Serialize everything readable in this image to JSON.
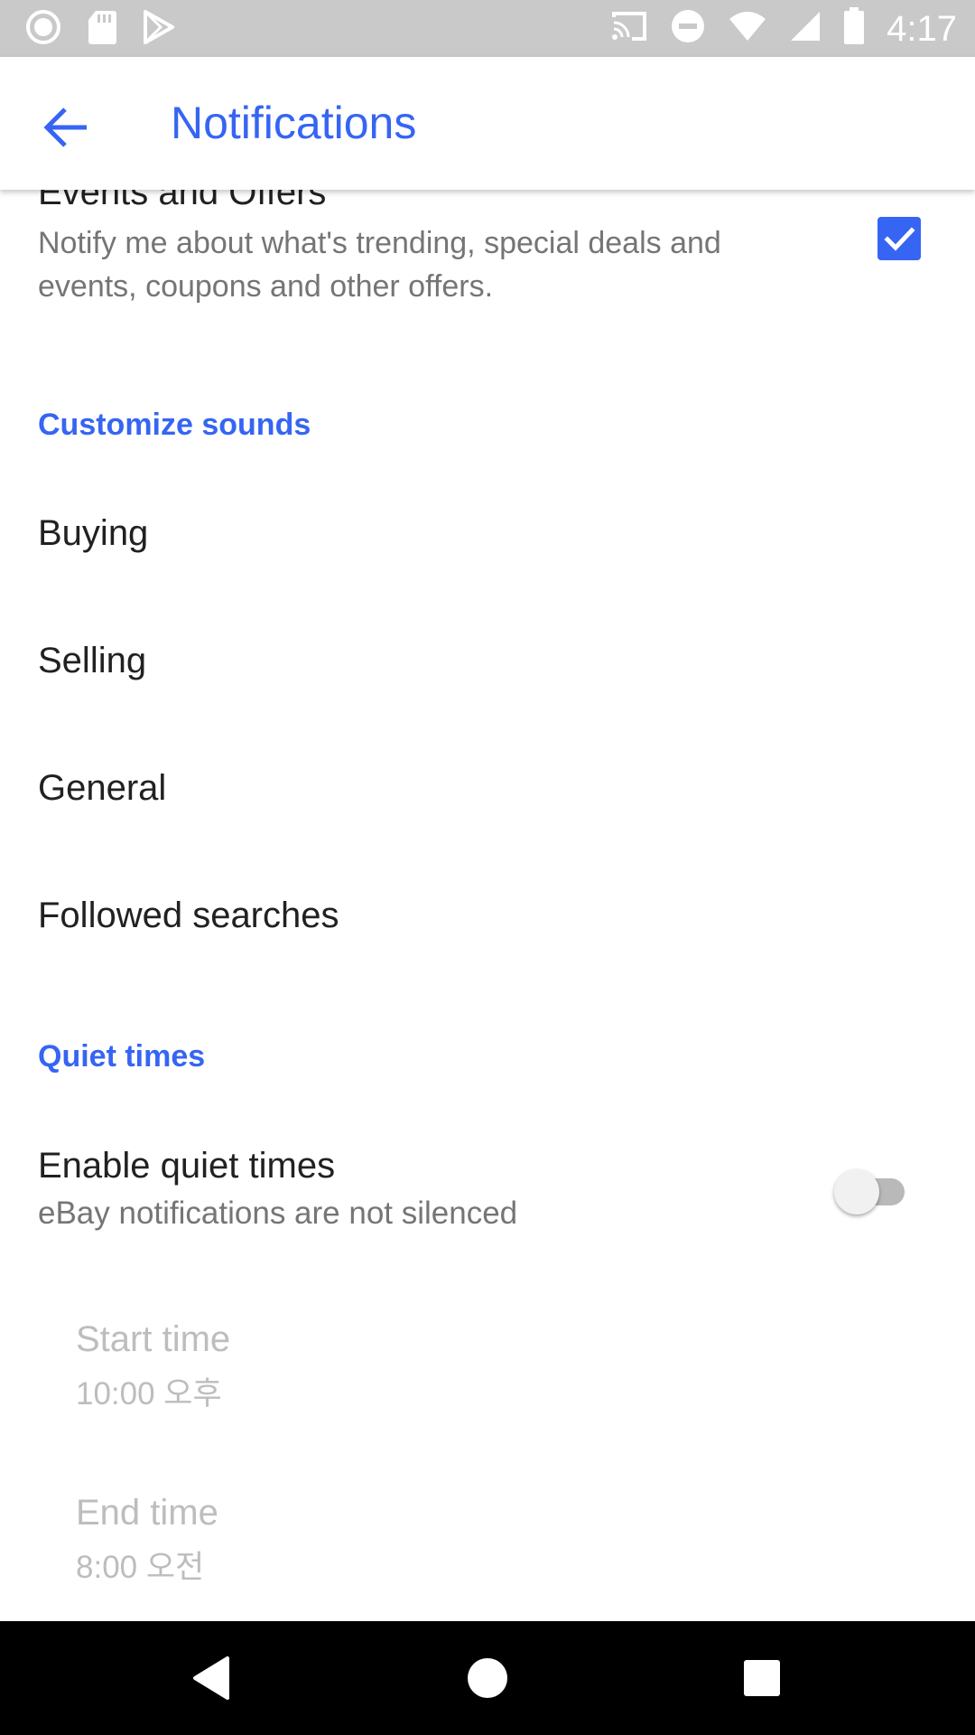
{
  "status_bar": {
    "time": "4:17",
    "left_icons": [
      "record-icon",
      "sd-card-icon",
      "play-store-icon"
    ],
    "right_icons": [
      "cast-icon",
      "do-not-disturb-icon",
      "wifi-icon",
      "signal-icon",
      "battery-icon"
    ]
  },
  "app_bar": {
    "title": "Notifications",
    "back_icon": "arrow-back-icon"
  },
  "events": {
    "title": "Events and Offers",
    "description": "Notify me about what's trending, special deals and events, coupons and other offers.",
    "checked": true
  },
  "sections": {
    "customize_sounds": "Customize sounds",
    "quiet_times": "Quiet times"
  },
  "sound_items": [
    {
      "label": "Buying"
    },
    {
      "label": "Selling"
    },
    {
      "label": "General"
    },
    {
      "label": "Followed searches"
    }
  ],
  "quiet": {
    "enable_title": "Enable quiet times",
    "enable_subtitle": "eBay notifications are not silenced",
    "enabled": false,
    "start_label": "Start time",
    "start_value": "10:00 오후",
    "end_label": "End time",
    "end_value": "8:00 오전"
  },
  "nav_bar": {
    "buttons": [
      "back-triangle-icon",
      "home-circle-icon",
      "recents-square-icon"
    ]
  },
  "colors": {
    "accent": "#3665f3",
    "status_bar": "#c9c9c9",
    "primary_text": "#212121",
    "secondary_text": "#757575",
    "disabled_text": "#bdbdbd"
  }
}
